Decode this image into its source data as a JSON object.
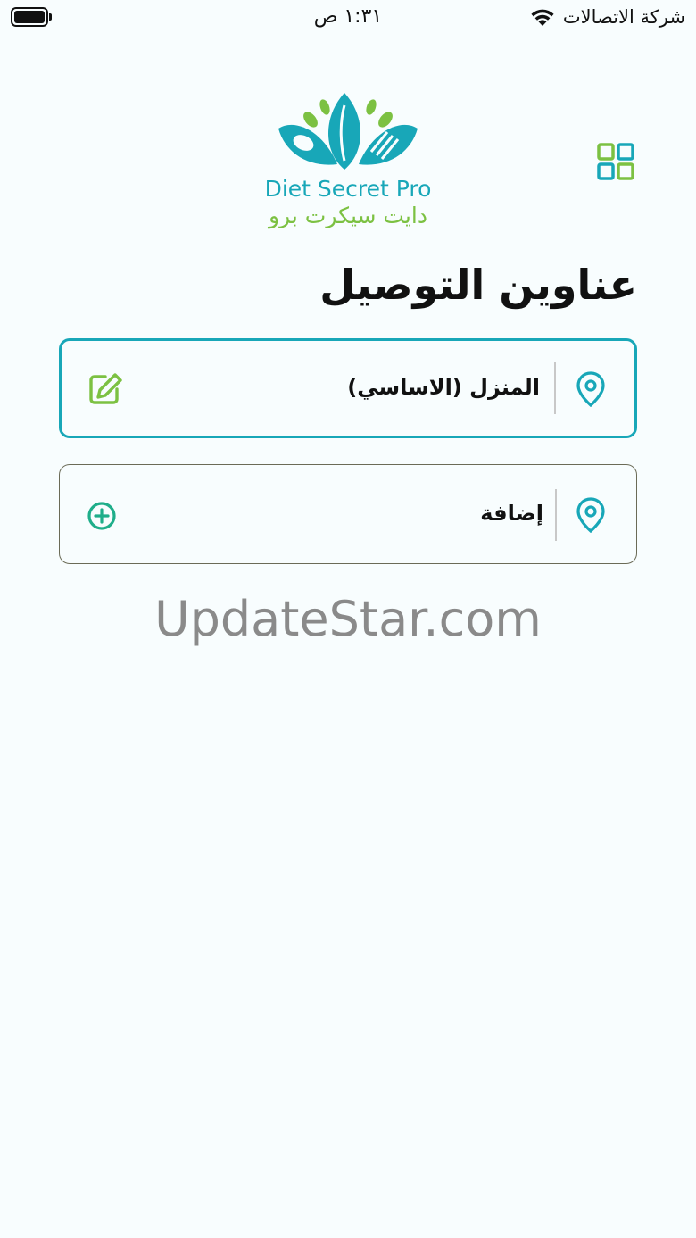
{
  "status_bar": {
    "time": "١:٣١ ص",
    "carrier": "شركة الاتصالات"
  },
  "header": {
    "logo_en": "Diet Secret Pro",
    "logo_ar": "دايت سيكرت برو"
  },
  "page": {
    "title": "عناوين التوصيل"
  },
  "addresses": [
    {
      "label": "المنزل (الاساسي)",
      "action": "edit-icon"
    },
    {
      "label": "إضافة",
      "action": "add-circle-icon"
    }
  ],
  "watermark": "UpdateStar.com",
  "colors": {
    "accent_teal": "#18a7b8",
    "accent_green": "#7cc142",
    "background": "#f8fdfe"
  }
}
